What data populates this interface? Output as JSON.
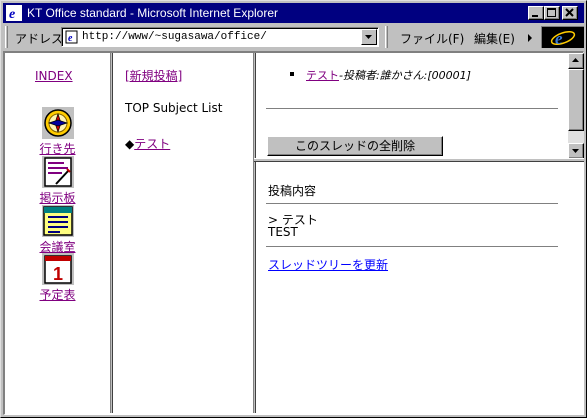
{
  "window": {
    "title": "KT Office standard     - Microsoft Internet Explorer"
  },
  "addressbar": {
    "label": "アドレス",
    "url": "http://www/~sugasawa/office/"
  },
  "menu": {
    "file": "ファイル(F)",
    "edit": "編集(E)"
  },
  "nav": {
    "index": "INDEX",
    "items": [
      {
        "label": "行き先",
        "icon": "compass-icon"
      },
      {
        "label": "掲示板",
        "icon": "bulletin-board-icon"
      },
      {
        "label": "会議室",
        "icon": "meeting-room-icon"
      },
      {
        "label": "予定表",
        "icon": "calendar-icon"
      }
    ],
    "calendar_day": "1"
  },
  "middle": {
    "new_post": "[新規投稿]",
    "subject_list_title": "TOP Subject List",
    "thread_marker": "◆",
    "thread_link": "テスト"
  },
  "thread_tree": {
    "item_link": "テスト",
    "item_meta": "-投稿者:誰かさん:[00001]",
    "delete_button": "このスレッドの全削除"
  },
  "post": {
    "heading": "投稿内容",
    "subject": "> テスト",
    "body": "TEST",
    "refresh_link": "スレッドツリーを更新"
  },
  "colors": {
    "titlebar": "#000080",
    "chrome": "#c0c0c0",
    "link": "#0000ff",
    "visited": "#800080"
  }
}
